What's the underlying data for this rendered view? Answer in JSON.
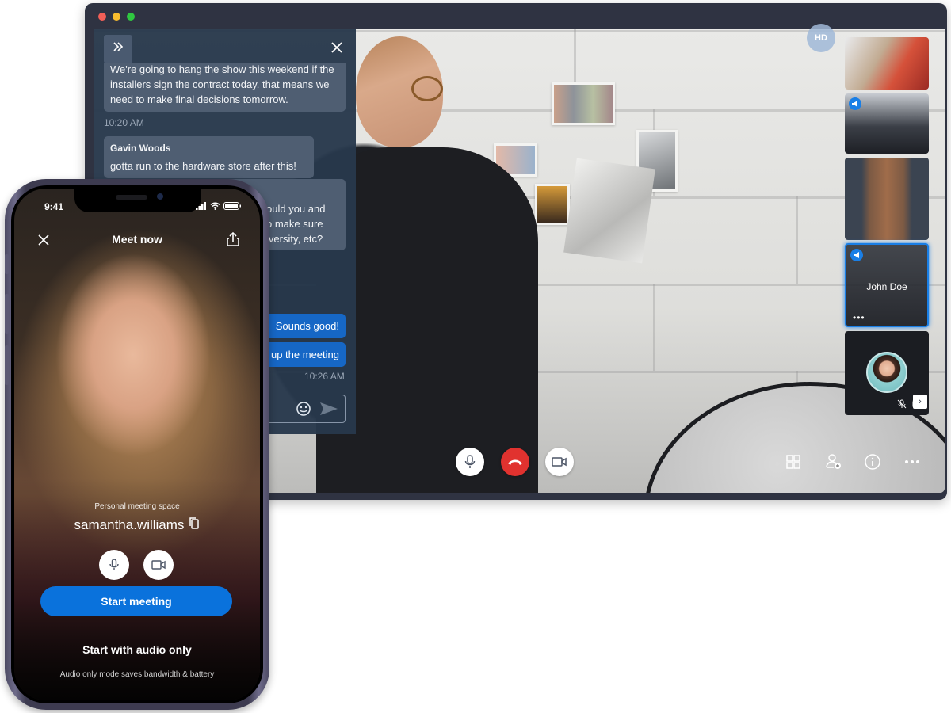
{
  "desktop": {
    "window_controls": [
      "close",
      "minimize",
      "maximize"
    ],
    "chat": {
      "expand_icon": "double-chevron-right-icon",
      "close_icon": "close-icon",
      "messages": [
        {
          "sender": "",
          "text": "We're going to hang the show this weekend if the installers sign the contract today. that means we need to make final decisions tomorrow.",
          "mine": false
        },
        {
          "sender": "Gavin Woods",
          "text": "gotta run to the hardware store after this!",
          "mine": false
        },
        {
          "sender": "",
          "text": "...ould you and ...o make sure ...iversity, etc?",
          "mine": false
        },
        {
          "sender": "",
          "text": "Sounds good!",
          "mine": true
        },
        {
          "sender": "",
          "text": "...up the meeting",
          "mine": true
        }
      ],
      "timestamps": [
        "10:20 AM",
        "10:26 AM"
      ],
      "input_placeholder": "",
      "emoji_icon": "smiley-icon",
      "send_icon": "send-icon"
    },
    "video": {
      "quality_badge": "HD",
      "participants": [
        {
          "name": "",
          "state": "video",
          "speaking": false
        },
        {
          "name": "",
          "state": "video",
          "speaking": true
        },
        {
          "name": "",
          "state": "video",
          "speaking": false
        },
        {
          "name": "John Doe",
          "state": "active",
          "speaking": true
        },
        {
          "name": "",
          "state": "avatar",
          "muted": true,
          "video_off": true
        }
      ],
      "strip_next_label": "›",
      "controls": {
        "mic": "microphone-icon",
        "end_call": "hang-up-icon",
        "camera": "video-camera-icon"
      },
      "tools": [
        "grid-layout-icon",
        "add-participant-icon",
        "info-icon",
        "more-icon"
      ]
    }
  },
  "phone": {
    "status_time": "9:41",
    "title": "Meet now",
    "close_icon": "close-icon",
    "share_icon": "share-icon",
    "pms_label": "Personal meeting space",
    "pms_name": "samantha.williams",
    "copy_icon": "copy-icon",
    "start_meeting": "Start meeting",
    "audio_only": "Start with audio only",
    "audio_note": "Audio only mode saves bandwidth & battery"
  },
  "colors": {
    "accent": "#0a72dc",
    "end_call": "#e1322f",
    "chat_panel": "#28384c",
    "my_bubble": "#1667c6",
    "window_frame": "#2f3342"
  }
}
